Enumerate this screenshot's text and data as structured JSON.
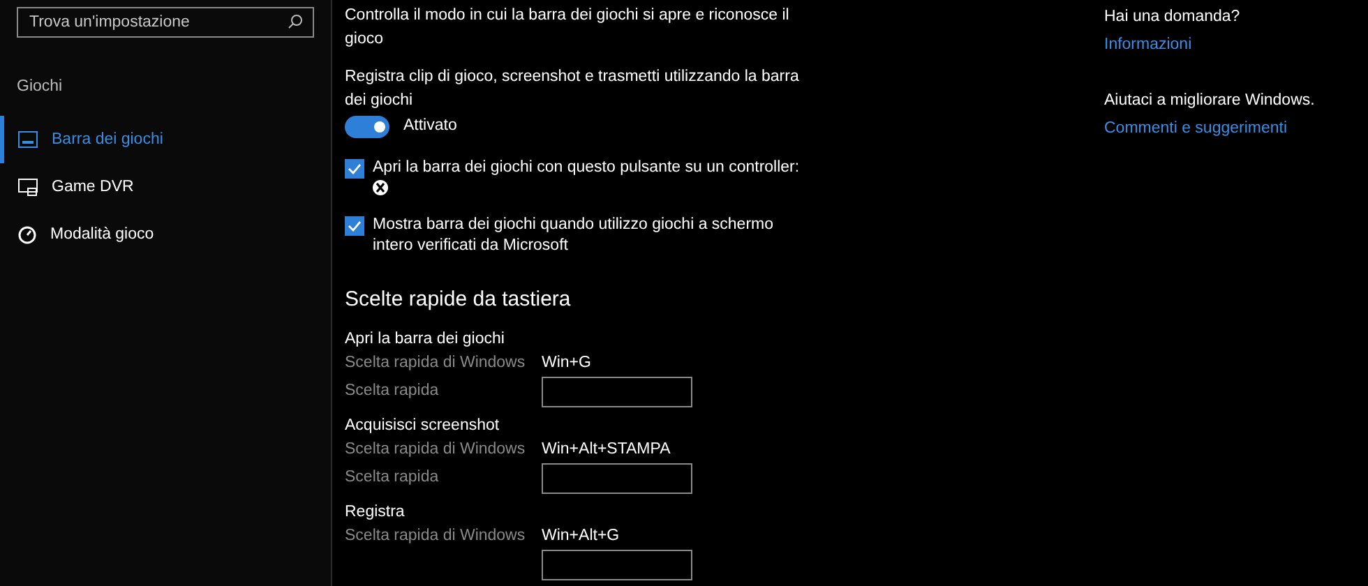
{
  "search": {
    "placeholder": "Trova un'impostazione"
  },
  "sidebar": {
    "heading": "Giochi",
    "items": [
      {
        "label": "Barra dei giochi",
        "kind": "bar",
        "selected": true
      },
      {
        "label": "Game DVR",
        "kind": "dvr",
        "selected": false
      },
      {
        "label": "Modalità gioco",
        "kind": "mode",
        "selected": false
      }
    ]
  },
  "main": {
    "intro": "Controlla il modo in cui la barra dei giochi si apre e riconosce il gioco",
    "record_label": "Registra clip di gioco, screenshot e trasmetti utilizzando la barra dei giochi",
    "toggle": {
      "on": true,
      "label": "Attivato"
    },
    "checkboxes": [
      {
        "label": "Apri la barra dei giochi con questo pulsante su un controller:",
        "checked": true,
        "kind": "controller"
      },
      {
        "label": "Mostra barra dei giochi quando utilizzo giochi a schermo intero verificati da Microsoft",
        "checked": true,
        "kind": "plain"
      }
    ],
    "shortcuts_heading": "Scelte rapide da tastiera",
    "shortcuts": [
      {
        "title": "Apri la barra dei giochi",
        "windows_label": "Scelta rapida di Windows",
        "windows_value": "Win+G",
        "custom_label": "Scelta rapida"
      },
      {
        "title": "Acquisisci screenshot",
        "windows_label": "Scelta rapida di Windows",
        "windows_value": "Win+Alt+STAMPA",
        "custom_label": "Scelta rapida"
      },
      {
        "title": "Registra",
        "windows_label": "Scelta rapida di Windows",
        "windows_value": "Win+Alt+G"
      }
    ]
  },
  "aside": [
    {
      "heading": "Hai una domanda?",
      "link": "Informazioni"
    },
    {
      "heading": "Aiutaci a migliorare Windows.",
      "link": "Commenti e suggerimenti"
    }
  ]
}
